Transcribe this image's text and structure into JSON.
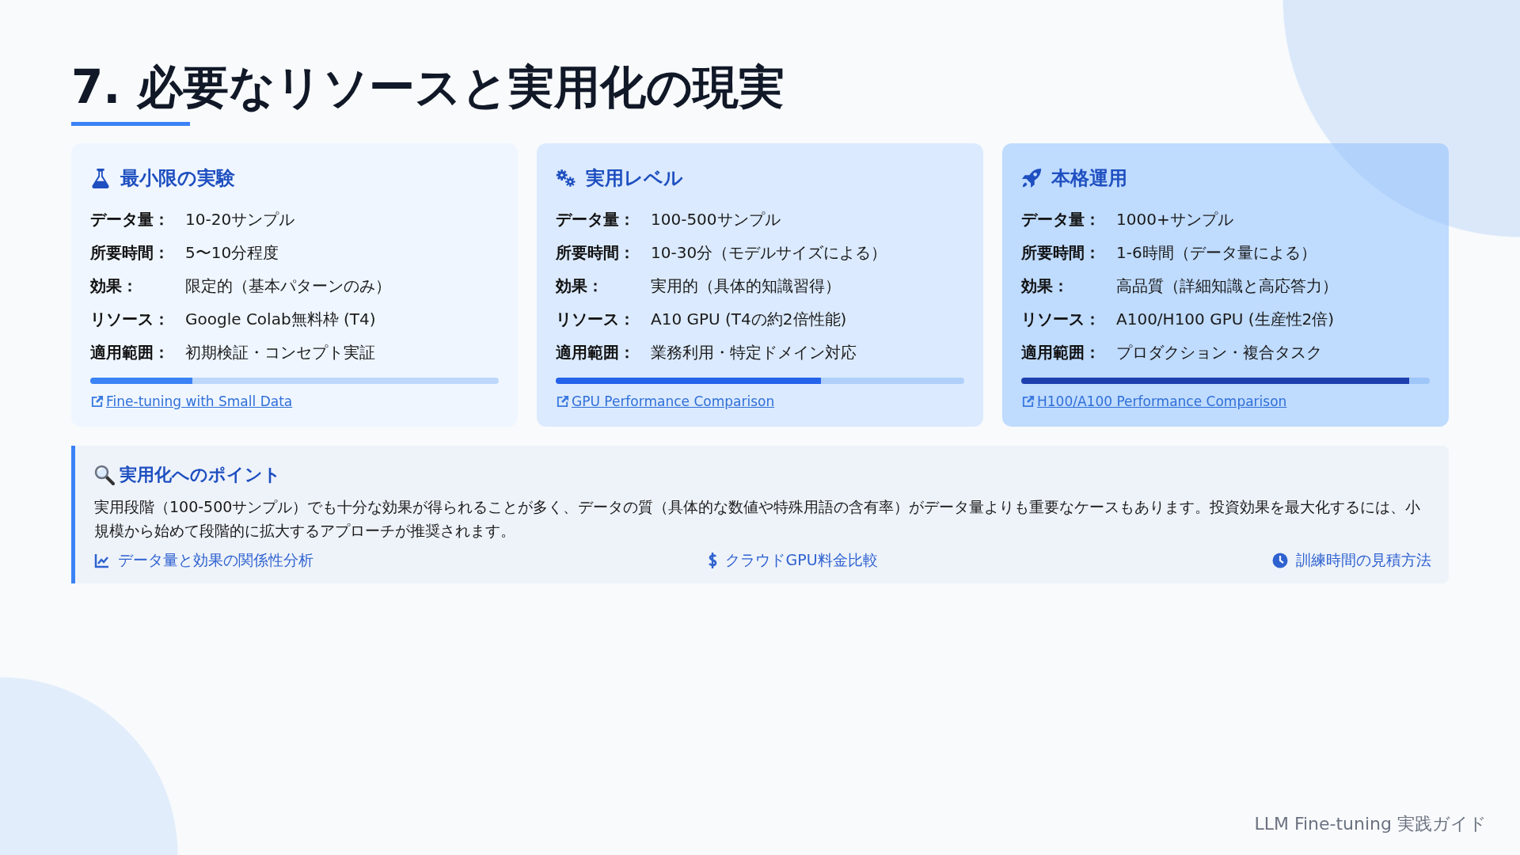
{
  "title": "7. 必要なリソースと実用化の現実",
  "cards": [
    {
      "heading": "最小限の実験",
      "kind": "minimal",
      "color": "#3b82f6",
      "level": 0.25,
      "link": "Fine-tuning with Small Data",
      "rows": [
        {
          "label": "データ量：",
          "value": "10-20サンプル"
        },
        {
          "label": "所要時間：",
          "value": "5〜10分程度"
        },
        {
          "label": "効果：",
          "value": "限定的（基本パターンのみ）"
        },
        {
          "label": "リソース：",
          "value": "Google Colab無料枠 (T4)"
        },
        {
          "label": "適用範囲：",
          "value": "初期検証・コンセプト実証"
        }
      ]
    },
    {
      "heading": "実用レベル",
      "kind": "practical",
      "color": "#2563eb",
      "level": 0.65,
      "link": "GPU Performance Comparison",
      "rows": [
        {
          "label": "データ量：",
          "value": "100-500サンプル"
        },
        {
          "label": "所要時間：",
          "value": "10-30分（モデルサイズによる）"
        },
        {
          "label": "効果：",
          "value": "実用的（具体的知識習得）"
        },
        {
          "label": "リソース：",
          "value": "A10 GPU (T4の約2倍性能)"
        },
        {
          "label": "適用範囲：",
          "value": "業務利用・特定ドメイン対応"
        }
      ]
    },
    {
      "heading": "本格運用",
      "kind": "production",
      "color": "#1e40af",
      "level": 0.95,
      "link": "H100/A100 Performance Comparison",
      "rows": [
        {
          "label": "データ量：",
          "value": "1000+サンプル"
        },
        {
          "label": "所要時間：",
          "value": "1-6時間（データ量による）"
        },
        {
          "label": "効果：",
          "value": "高品質（詳細知識と高応答力）"
        },
        {
          "label": "リソース：",
          "value": "A100/H100 GPU (生産性2倍)"
        },
        {
          "label": "適用範囲：",
          "value": "プロダクション・複合タスク"
        }
      ]
    }
  ],
  "tip": {
    "heading": "実用化へのポイント",
    "text": "実用段階（100-500サンプル）でも十分な効果が得られることが多く、データの質（具体的な数値や特殊用語の含有率）がデータ量よりも重要なケースもあります。投資効果を最大化するには、小規模から始めて段階的に拡大するアプローチが推奨されます。",
    "links": [
      "データ量と効果の関係性分析",
      "クラウドGPU料金比較",
      "訓練時間の見積方法"
    ]
  },
  "footer": "LLM Fine-tuning 実践ガイド"
}
